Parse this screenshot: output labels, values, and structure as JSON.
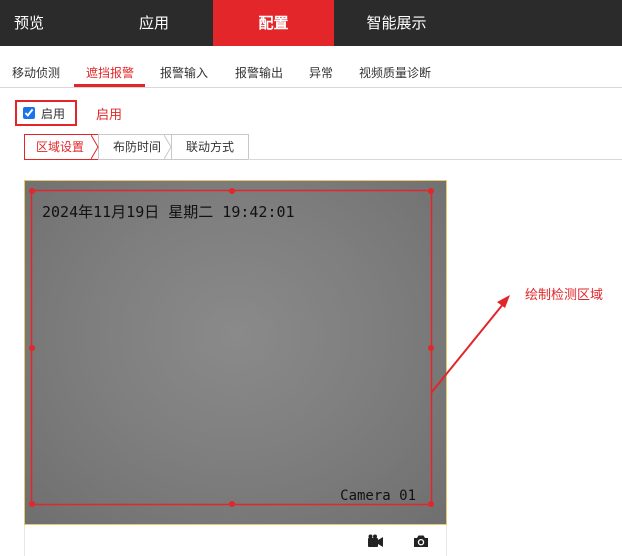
{
  "topnav": {
    "items": [
      {
        "label": "预览"
      },
      {
        "label": "应用"
      },
      {
        "label": "配置",
        "active": true
      },
      {
        "label": "智能展示"
      }
    ]
  },
  "subnav": {
    "items": [
      {
        "label": "移动侦测"
      },
      {
        "label": "遮挡报警",
        "active": true
      },
      {
        "label": "报警输入"
      },
      {
        "label": "报警输出"
      },
      {
        "label": "异常"
      },
      {
        "label": "视频质量诊断"
      }
    ]
  },
  "enable": {
    "checked": true,
    "label": "启用",
    "annotation": "启用"
  },
  "steps": {
    "items": [
      {
        "label": "区域设置",
        "active": true
      },
      {
        "label": "布防时间"
      },
      {
        "label": "联动方式"
      }
    ]
  },
  "video": {
    "osd_time": "2024年11月19日 星期二 19:42:01",
    "osd_camera": "Camera 01"
  },
  "annotation": {
    "draw_region": "绘制检测区域"
  },
  "icons": {
    "record": "video-record-icon",
    "snapshot": "camera-snapshot-icon"
  },
  "colors": {
    "accent": "#e2262a",
    "nav_bg": "#2b2b2b"
  }
}
